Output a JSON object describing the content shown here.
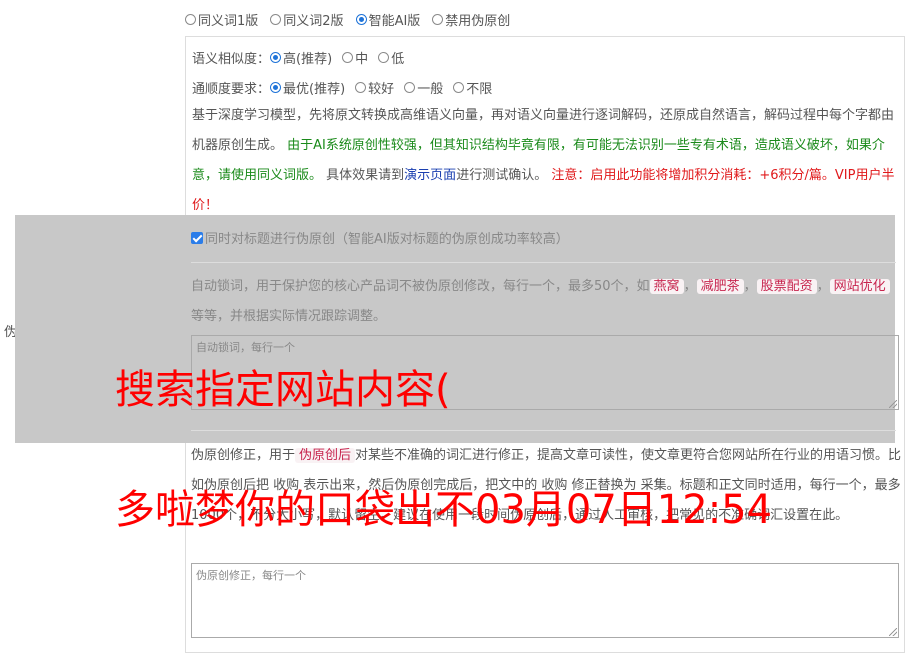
{
  "side_label": "伪原创设置",
  "modes": [
    {
      "label": "同义词1版",
      "checked": false
    },
    {
      "label": "同义词2版",
      "checked": false
    },
    {
      "label": "智能AI版",
      "checked": true
    },
    {
      "label": "禁用伪原创",
      "checked": false
    }
  ],
  "similarity": {
    "label": "语义相似度：",
    "options": [
      {
        "label": "高(推荐)",
        "checked": true
      },
      {
        "label": "中",
        "checked": false
      },
      {
        "label": "低",
        "checked": false
      }
    ]
  },
  "fluency": {
    "label": "通顺度要求：",
    "options": [
      {
        "label": "最优(推荐)",
        "checked": true
      },
      {
        "label": "较好",
        "checked": false
      },
      {
        "label": "一般",
        "checked": false
      },
      {
        "label": "不限",
        "checked": false
      }
    ]
  },
  "description": {
    "p1": "基于深度学习模型，先将原文转换成高维语义向量，再对语义向量进行逐词解码，还原成自然语言，解码过程中每个字都由机器原创生成。",
    "green": "由于AI系统原创性较强，但其知识结构毕竟有限，有可能无法识别一些专有术语，造成语义破坏，如果介意，请使用同义词版。",
    "p2a": "具体效果请到",
    "link": "演示页面",
    "p2b": "进行测试确认。",
    "red": "注意：启用此功能将增加积分消耗：+6积分/篇。VIP用户半价！"
  },
  "title_checkbox": "同时对标题进行伪原创（智能AI版对标题的伪原创成功率较高）",
  "lock": {
    "text_a": "自动锁词，用于保护您的核心产品词不被伪原创修改，每行一个，最多50个，如",
    "tags": [
      "燕窝",
      "减肥茶",
      "股票配资",
      "网站优化"
    ],
    "sep": "，",
    "text_b": "等等，并根据实际情况跟踪调整。",
    "placeholder": "自动锁词，每行一个"
  },
  "fix": {
    "text_a": "伪原创修正，用于",
    "tag": "伪原创后",
    "text_b": "对某些不准确的词汇进行修正，提高文章可读性，使文章更符合您网站所在行业的用语习惯。比如伪原创后把 收购 表示出来，然后伪原创完成后，把文中的 收购 修正替换为 采集。标题和正文同时适用，每行一个，最多1000个，不分大小写，默认留空。建议在使用一段时间伪原创后，通过人工审核，把常见的不准确词汇设置在此。",
    "placeholder": "伪原创修正，每行一个"
  },
  "overlay_text_1": "搜索指定网站内容(",
  "overlay_text_2": "多啦梦你的口袋出不03月07日12:54"
}
